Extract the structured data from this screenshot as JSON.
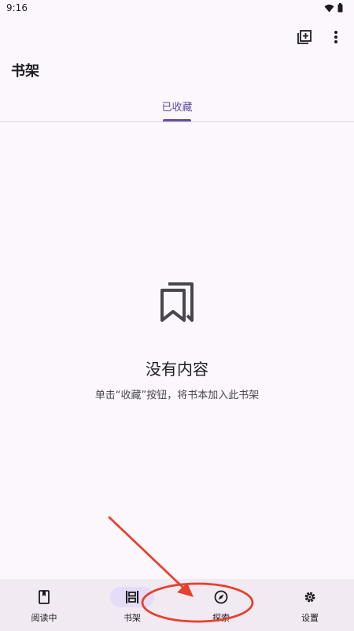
{
  "status_bar": {
    "time": "9:16"
  },
  "header": {
    "title": "书架"
  },
  "tabs": [
    {
      "label": "已收藏",
      "active": true
    }
  ],
  "empty_state": {
    "title": "没有内容",
    "description": "单击“收藏”按钮，将书本加入此书架"
  },
  "bottom_nav": {
    "items": [
      {
        "label": "阅读中",
        "icon": "book-icon",
        "active": false
      },
      {
        "label": "书架",
        "icon": "bookshelf-icon",
        "active": true
      },
      {
        "label": "探索",
        "icon": "compass-icon",
        "active": false
      },
      {
        "label": "设置",
        "icon": "gear-icon",
        "active": false
      }
    ]
  },
  "colors": {
    "background": "#FCF7FD",
    "accent": "#6750A4",
    "nav_background": "#F1EAF2",
    "annotation": "#E8402E"
  }
}
